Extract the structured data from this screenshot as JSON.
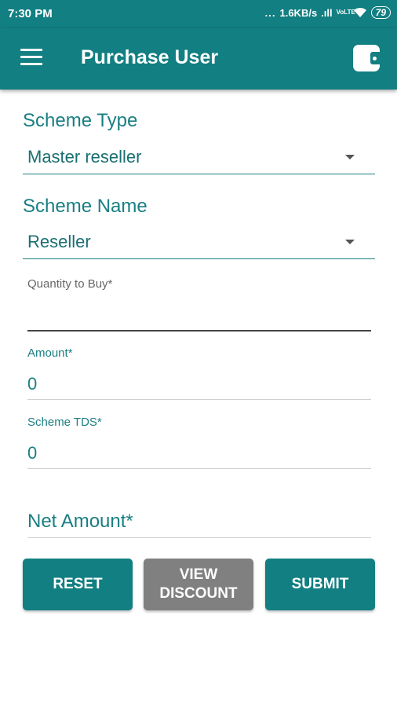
{
  "status_bar": {
    "time": "7:30 PM",
    "dots": "...",
    "speed": "1.6KB/s",
    "signal_text": ".ıll",
    "volte": "VoLTE",
    "wifi": "wifi",
    "battery": "79"
  },
  "app_bar": {
    "title": "Purchase User",
    "menu_icon": "hamburger-menu-icon",
    "wallet_icon": "wallet-icon"
  },
  "form": {
    "scheme_type_label": "Scheme Type",
    "scheme_type_value": "Master reseller",
    "scheme_name_label": "Scheme Name",
    "scheme_name_value": "Reseller",
    "quantity_label": "Quantity to Buy*",
    "quantity_value": "",
    "amount_label": "Amount*",
    "amount_value": "0",
    "scheme_tds_label": "Scheme TDS*",
    "scheme_tds_value": "0",
    "net_amount_label": "Net Amount*"
  },
  "buttons": {
    "reset": "RESET",
    "view_discount_line1": "VIEW",
    "view_discount_line2": "DISCOUNT",
    "submit": "SUBMIT"
  },
  "colors": {
    "primary": "#127f82",
    "button_disabled": "#808080"
  }
}
